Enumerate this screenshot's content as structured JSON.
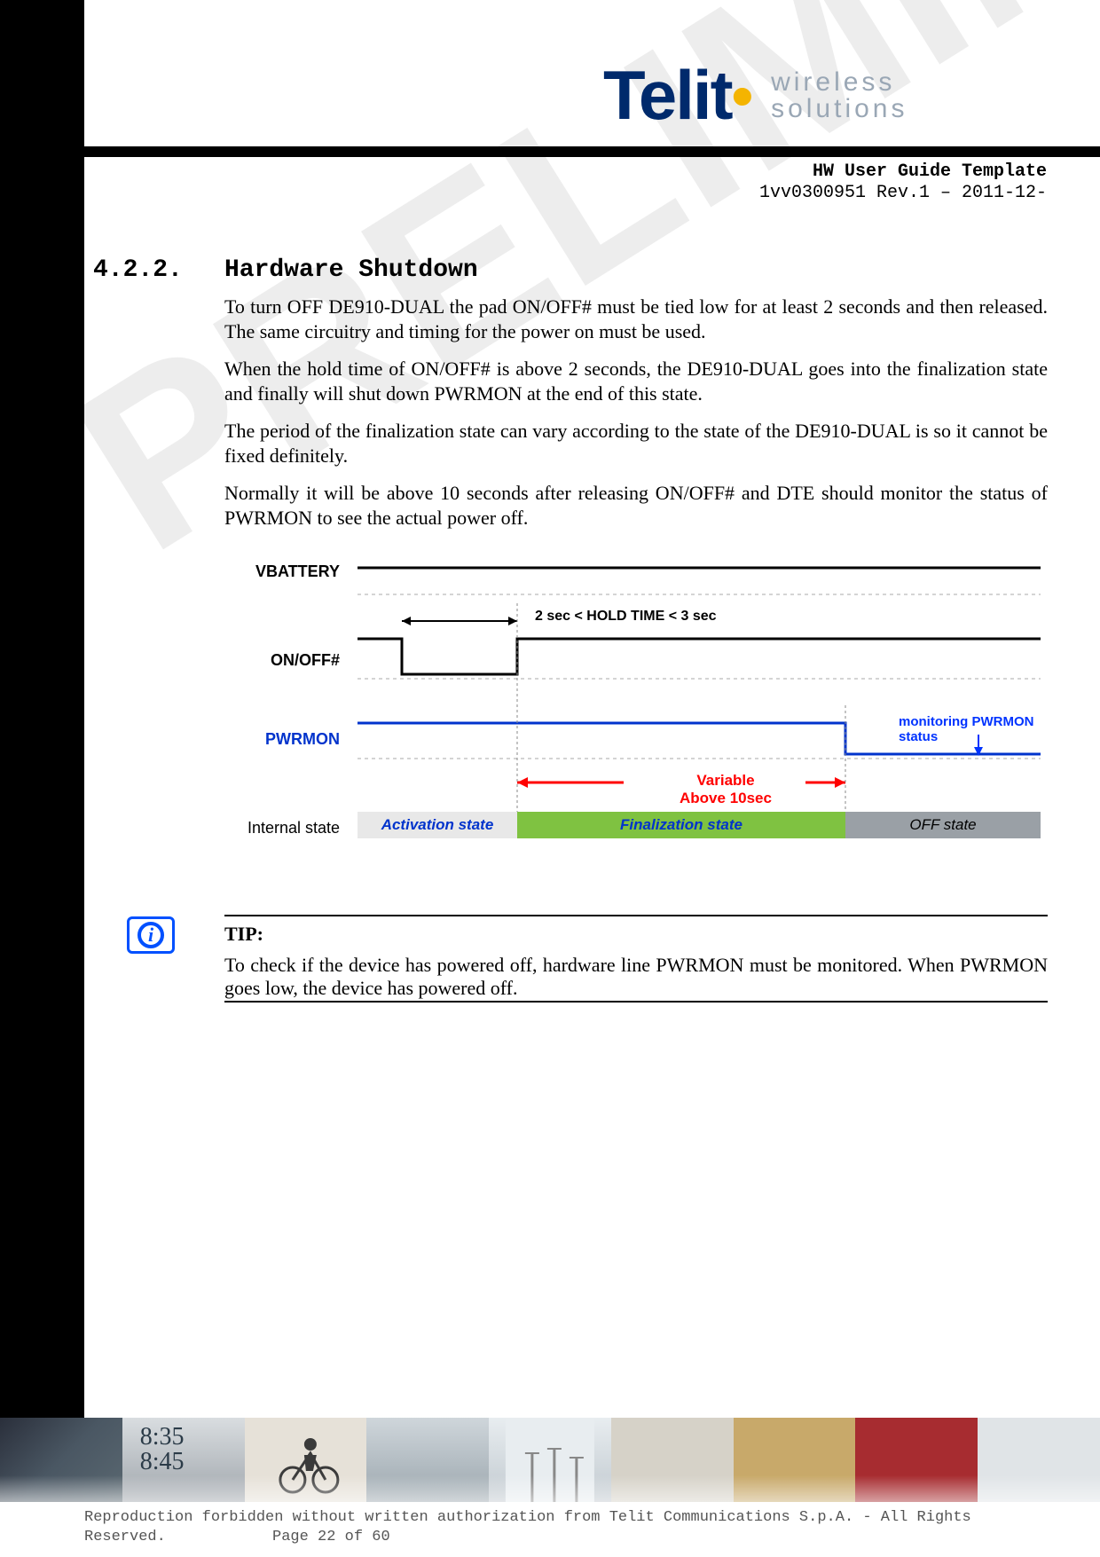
{
  "header": {
    "brand": "Telit",
    "tagline1": "wireless",
    "tagline2": "solutions",
    "doc_title": "HW User Guide Template",
    "doc_rev": "1vv0300951 Rev.1 – 2011-12-"
  },
  "watermark": "PRELIMINARY",
  "section": {
    "number": "4.2.2.",
    "title": "Hardware Shutdown",
    "p1": "To turn OFF DE910-DUAL the pad ON/OFF# must be tied low for at least 2 seconds and then released. The same circuitry and timing for the power on must be used.",
    "p2": "When the hold time of ON/OFF# is above 2 seconds, the DE910-DUAL goes into the finalization state and finally will shut down PWRMON at the end of this state.",
    "p3": "The period of the finalization state can vary according to the state of the DE910-DUAL is so it cannot be fixed definitely.",
    "p4": "Normally it will be above 10 seconds after releasing ON/OFF# and DTE should monitor the status of PWRMON to see the actual power off."
  },
  "diagram": {
    "labels": {
      "vbattery": "VBATTERY",
      "onoff": "ON/OFF#",
      "pwrmon": "PWRMON",
      "internal_state": "Internal state"
    },
    "hold_time": "2 sec < HOLD TIME < 3 sec",
    "monitoring": "monitoring PWRMON status",
    "variable_line1": "Variable",
    "variable_line2": "Above 10sec",
    "state_activation": "Activation state",
    "state_finalization": "Finalization state",
    "state_off": "OFF state"
  },
  "tip": {
    "title": "TIP:",
    "body": "To check if the device has powered off, hardware line PWRMON must be monitored. When PWRMON goes low, the device has powered off."
  },
  "footer": {
    "clock1": "8:35",
    "clock2": "8:45",
    "line1": "Reproduction forbidden without written authorization from Telit Communications S.p.A. - All Rights",
    "reserved": "Reserved.",
    "page": "Page 22 of 60"
  }
}
